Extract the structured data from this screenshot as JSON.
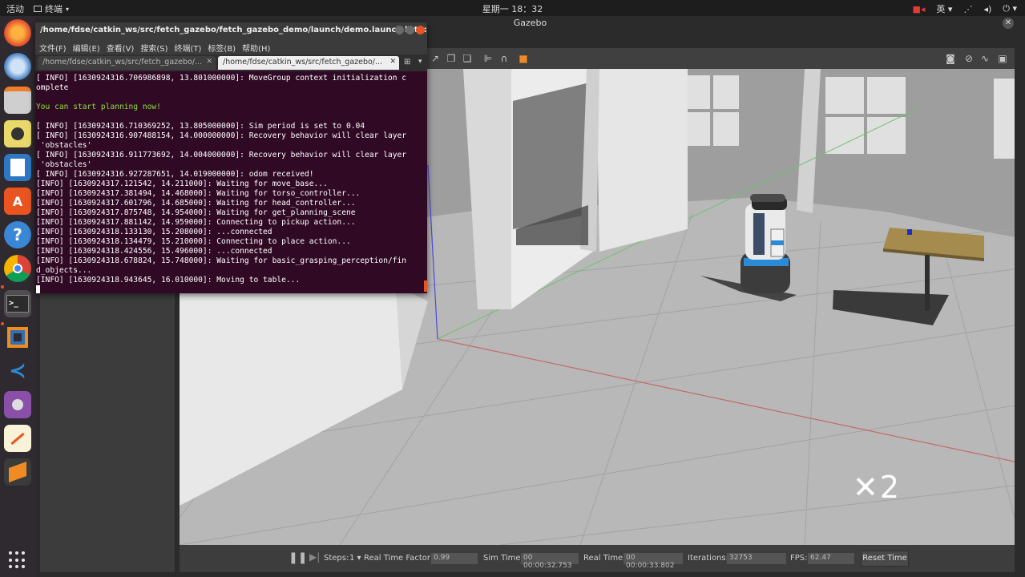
{
  "topbar": {
    "activities": "活动",
    "app_menu": "终端",
    "clock": "星期一 18：32",
    "input_method": "英",
    "colors": {
      "bg": "#1d1d1d",
      "text": "#dcdcdc"
    }
  },
  "dock": {
    "apps": [
      {
        "name": "firefox",
        "icon": "firefox-icon"
      },
      {
        "name": "thunderbird",
        "icon": "mail-icon"
      },
      {
        "name": "files",
        "icon": "files-icon"
      },
      {
        "name": "rhythmbox",
        "icon": "music-icon"
      },
      {
        "name": "writer",
        "icon": "document-icon"
      },
      {
        "name": "software",
        "icon": "software-center-icon"
      },
      {
        "name": "help",
        "icon": "help-icon",
        "glyph": "?"
      },
      {
        "name": "chrome",
        "icon": "chrome-icon"
      },
      {
        "name": "terminal",
        "icon": "terminal-icon",
        "glyph": ">_"
      },
      {
        "name": "vmware",
        "icon": "vm-icon"
      },
      {
        "name": "vscode",
        "icon": "vscode-icon"
      },
      {
        "name": "video",
        "icon": "video-icon"
      },
      {
        "name": "text-editor",
        "icon": "text-editor-icon"
      },
      {
        "name": "sublime",
        "icon": "sublime-icon"
      }
    ]
  },
  "gazebo": {
    "title": "Gazebo",
    "overlay_speed": "✕2",
    "bottom": {
      "steps_label": "Steps:",
      "steps_value": "1",
      "rtf_label": "Real Time Factor:",
      "rtf_value": "0.99",
      "sim_time_label": "Sim Time:",
      "sim_time_value": "00 00:00:32.753",
      "real_time_label": "Real Time:",
      "real_time_value": "00 00:00:33.802",
      "iterations_label": "Iterations:",
      "iterations_value": "32753",
      "fps_label": "FPS:",
      "fps_value": "62.47",
      "reset_label": "Reset Time"
    }
  },
  "terminal": {
    "title": "/home/fdse/catkin_ws/src/fetch_gazebo/fetch_gazebo_demo/launch/demo.launch http://lo...",
    "menu": [
      "文件(F)",
      "编辑(E)",
      "查看(V)",
      "搜索(S)",
      "终端(T)",
      "标签(B)",
      "帮助(H)"
    ],
    "tabs": [
      {
        "label": "/home/fdse/catkin_ws/src/fetch_gazebo/..."
      },
      {
        "label": "/home/fdse/catkin_ws/src/fetch_gazebo/..."
      }
    ],
    "lines": [
      "[ INFO] [1630924316.706986898, 13.801000000]: MoveGroup context initialization c",
      "omplete",
      "",
      "You can start planning now!",
      "",
      "[ INFO] [1630924316.710369252, 13.805000000]: Sim period is set to 0.04",
      "[ INFO] [1630924316.907488154, 14.000000000]: Recovery behavior will clear layer",
      " 'obstacles'",
      "[ INFO] [1630924316.911773692, 14.004000000]: Recovery behavior will clear layer",
      " 'obstacles'",
      "[ INFO] [1630924316.927287651, 14.019000000]: odom received!",
      "[INFO] [1630924317.121542, 14.211000]: Waiting for move_base...",
      "[INFO] [1630924317.381494, 14.468000]: Waiting for torso_controller...",
      "[INFO] [1630924317.601796, 14.685000]: Waiting for head_controller...",
      "[INFO] [1630924317.875748, 14.954000]: Waiting for get_planning_scene",
      "[INFO] [1630924317.881142, 14.959000]: Connecting to pickup action...",
      "[INFO] [1630924318.133130, 15.208000]: ...connected",
      "[INFO] [1630924318.134479, 15.210000]: Connecting to place action...",
      "[INFO] [1630924318.424556, 15.496000]: ...connected",
      "[INFO] [1630924318.678824, 15.748000]: Waiting for basic_grasping_perception/fin",
      "d_objects...",
      "[INFO] [1630924318.943645, 16.010000]: Moving to table..."
    ],
    "colors": {
      "bg": "#300a24",
      "text": "#ffffff",
      "highlight": "#8ae234"
    }
  }
}
